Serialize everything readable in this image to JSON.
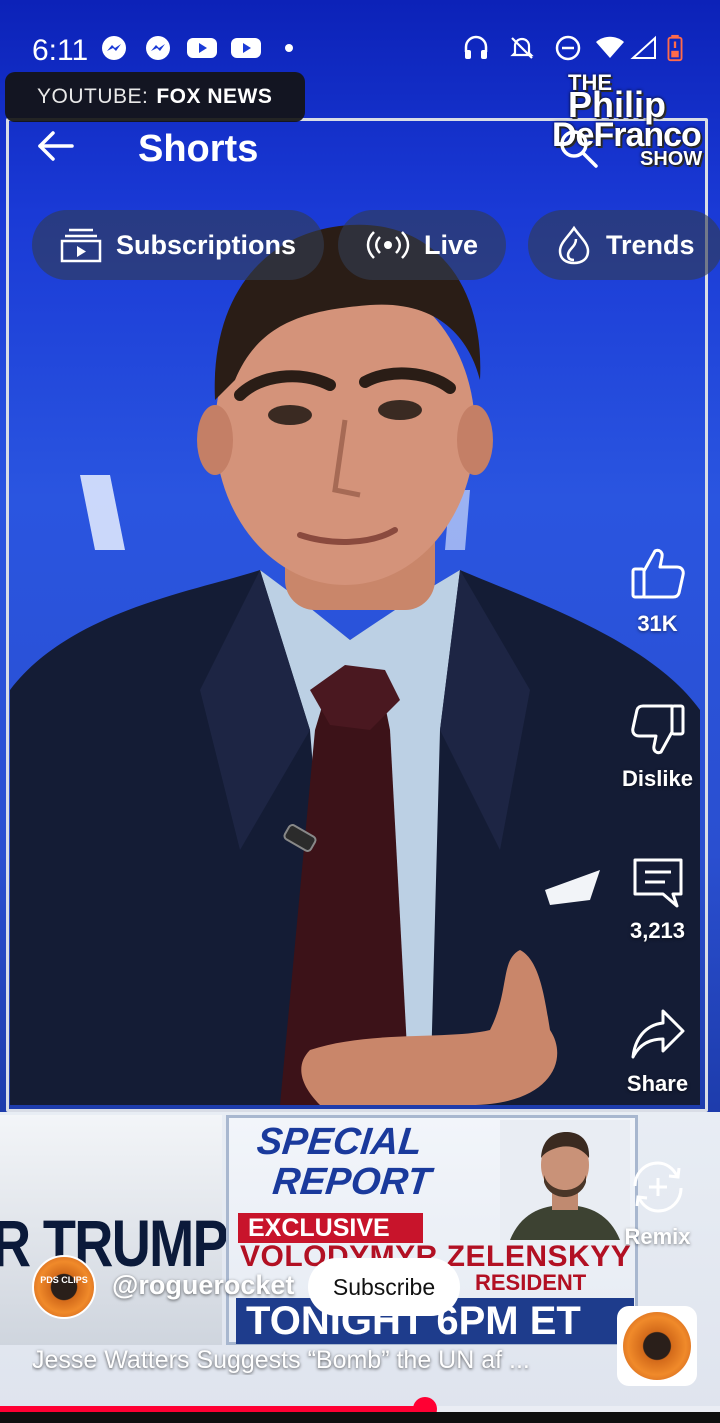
{
  "status_bar": {
    "time": "6:11"
  },
  "source_tag": {
    "prefix": "YOUTUBE:",
    "channel": "FOX NEWS"
  },
  "logo": {
    "line1": "THE",
    "line2": "Philip",
    "line3": "DeFranco",
    "line4": "SHOW"
  },
  "header": {
    "title": "Shorts"
  },
  "chips": [
    {
      "label": "Subscriptions",
      "icon": "subscriptions-icon"
    },
    {
      "label": "Live",
      "icon": "live-icon"
    },
    {
      "label": "Trends",
      "icon": "trends-icon"
    }
  ],
  "actions": {
    "like_count": "31K",
    "dislike_label": "Dislike",
    "comment_count": "3,213",
    "share_label": "Share",
    "remix_label": "Remix"
  },
  "video_overlay": {
    "trump_text": "R TRUMP",
    "special_title_1": "SPECIAL",
    "special_title_2": "REPORT",
    "exclusive": "EXCLUSIVE",
    "zelensky_line": "VOLODYMYR ZELENSKYY",
    "president_line": "RESIDENT",
    "tonight_line": "TONIGHT 6PM ET"
  },
  "channel": {
    "handle": "@roguerocket",
    "avatar_text": "PDS CLIPS",
    "subscribe_label": "Subscribe"
  },
  "video": {
    "title": "Jesse Watters Suggests “Bomb” the UN af ...",
    "progress": 0.59
  },
  "colors": {
    "accent_red": "#ff0033",
    "background_blue": "#1a3ad6"
  }
}
